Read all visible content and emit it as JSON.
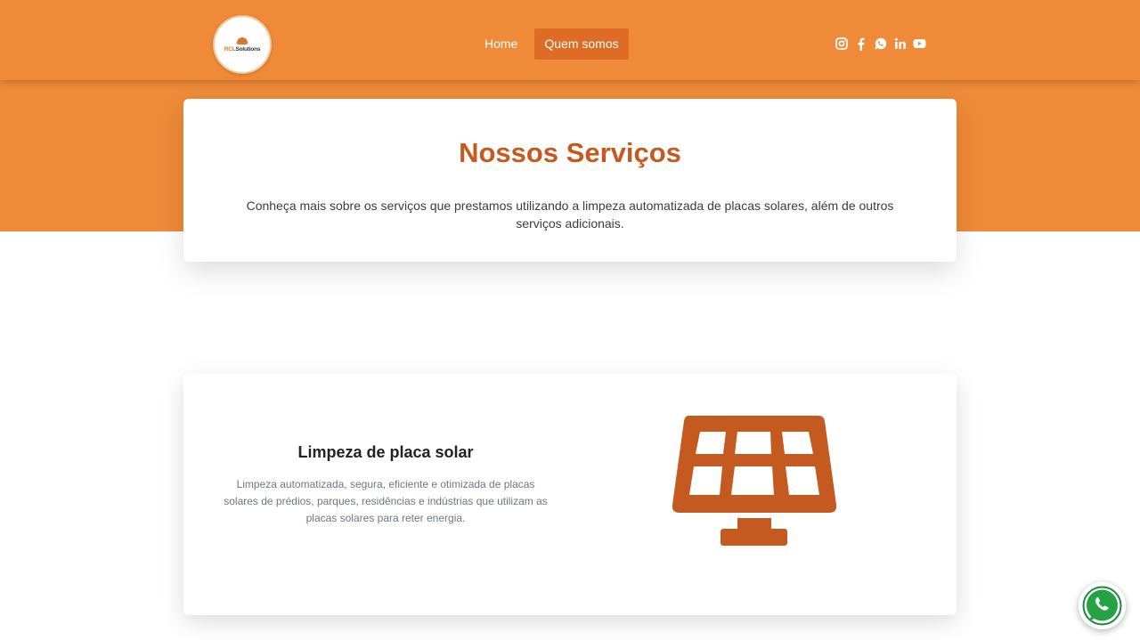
{
  "brand": {
    "logo_text_accent": "RCL",
    "logo_text_rest": "Solutions",
    "primary_color": "#ee8a38",
    "title_color": "#c55a20"
  },
  "nav": {
    "items": [
      {
        "label": "Home",
        "active": false
      },
      {
        "label": "Quem somos",
        "active": true
      }
    ]
  },
  "socials": [
    "instagram-icon",
    "facebook-icon",
    "whatsapp-icon",
    "linkedin-icon",
    "youtube-icon"
  ],
  "hero": {
    "title": "Nossos Serviços",
    "description": "Conheça mais sobre os serviços que prestamos utilizando a limpeza automatizada de placas solares, além de outros serviços adicionais."
  },
  "services": [
    {
      "title": "Limpeza de placa solar",
      "description": "Limpeza automatizada, segura, eficiente e otimizada de placas solares de prédios, parques, residências e indústrias que utilizam as placas solares para reter energia.",
      "icon": "solar-panel-icon"
    }
  ],
  "floating_button": {
    "icon": "whatsapp-icon"
  }
}
